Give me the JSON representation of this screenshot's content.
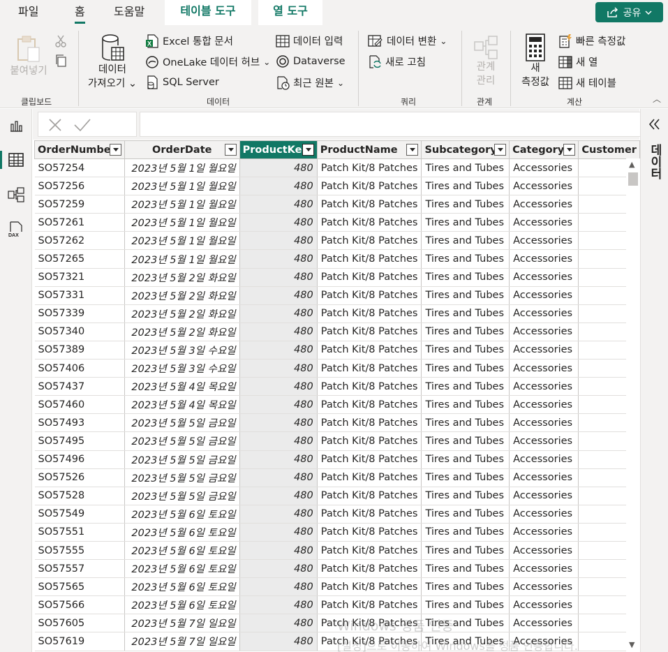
{
  "tabs": {
    "file": "파일",
    "home": "홈",
    "help": "도움말",
    "table_tools": "테이블 도구",
    "column_tools": "열 도구",
    "share": "공유"
  },
  "ribbon": {
    "clipboard": {
      "paste": "붙여넣기",
      "group": "클립보드"
    },
    "data": {
      "get_data_line1": "데이터",
      "get_data_line2": "가져오기",
      "excel": "Excel 통합 문서",
      "onelake": "OneLake 데이터 허브",
      "sql": "SQL Server",
      "enter_data": "데이터 입력",
      "dataverse": "Dataverse",
      "recent": "최근 원본",
      "group": "데이터"
    },
    "queries": {
      "transform": "데이터 변환",
      "refresh": "새로 고침",
      "group": "쿼리"
    },
    "relationships": {
      "manage_line1": "관계",
      "manage_line2": "관리",
      "group": "관계"
    },
    "calculations": {
      "new_measure_line1": "새",
      "new_measure_line2": "측정값",
      "quick_measure": "빠른 측정값",
      "new_column": "새 열",
      "new_table": "새 테이블",
      "group": "계산"
    }
  },
  "right_pane": {
    "title": "데이터"
  },
  "table": {
    "columns": [
      "OrderNumber",
      "OrderDate",
      "ProductKey",
      "ProductName",
      "Subcategory",
      "Category",
      "Customer"
    ],
    "selected_column": "ProductKey",
    "rows": [
      [
        "SO57254",
        "2023년 5월 1일 월요일",
        "480",
        "Patch Kit/8 Patches",
        "Tires and Tubes",
        "Accessories"
      ],
      [
        "SO57256",
        "2023년 5월 1일 월요일",
        "480",
        "Patch Kit/8 Patches",
        "Tires and Tubes",
        "Accessories"
      ],
      [
        "SO57259",
        "2023년 5월 1일 월요일",
        "480",
        "Patch Kit/8 Patches",
        "Tires and Tubes",
        "Accessories"
      ],
      [
        "SO57261",
        "2023년 5월 1일 월요일",
        "480",
        "Patch Kit/8 Patches",
        "Tires and Tubes",
        "Accessories"
      ],
      [
        "SO57262",
        "2023년 5월 1일 월요일",
        "480",
        "Patch Kit/8 Patches",
        "Tires and Tubes",
        "Accessories"
      ],
      [
        "SO57265",
        "2023년 5월 1일 월요일",
        "480",
        "Patch Kit/8 Patches",
        "Tires and Tubes",
        "Accessories"
      ],
      [
        "SO57321",
        "2023년 5월 2일 화요일",
        "480",
        "Patch Kit/8 Patches",
        "Tires and Tubes",
        "Accessories"
      ],
      [
        "SO57331",
        "2023년 5월 2일 화요일",
        "480",
        "Patch Kit/8 Patches",
        "Tires and Tubes",
        "Accessories"
      ],
      [
        "SO57339",
        "2023년 5월 2일 화요일",
        "480",
        "Patch Kit/8 Patches",
        "Tires and Tubes",
        "Accessories"
      ],
      [
        "SO57340",
        "2023년 5월 2일 화요일",
        "480",
        "Patch Kit/8 Patches",
        "Tires and Tubes",
        "Accessories"
      ],
      [
        "SO57389",
        "2023년 5월 3일 수요일",
        "480",
        "Patch Kit/8 Patches",
        "Tires and Tubes",
        "Accessories"
      ],
      [
        "SO57406",
        "2023년 5월 3일 수요일",
        "480",
        "Patch Kit/8 Patches",
        "Tires and Tubes",
        "Accessories"
      ],
      [
        "SO57437",
        "2023년 5월 4일 목요일",
        "480",
        "Patch Kit/8 Patches",
        "Tires and Tubes",
        "Accessories"
      ],
      [
        "SO57460",
        "2023년 5월 4일 목요일",
        "480",
        "Patch Kit/8 Patches",
        "Tires and Tubes",
        "Accessories"
      ],
      [
        "SO57493",
        "2023년 5월 5일 금요일",
        "480",
        "Patch Kit/8 Patches",
        "Tires and Tubes",
        "Accessories"
      ],
      [
        "SO57495",
        "2023년 5월 5일 금요일",
        "480",
        "Patch Kit/8 Patches",
        "Tires and Tubes",
        "Accessories"
      ],
      [
        "SO57496",
        "2023년 5월 5일 금요일",
        "480",
        "Patch Kit/8 Patches",
        "Tires and Tubes",
        "Accessories"
      ],
      [
        "SO57526",
        "2023년 5월 5일 금요일",
        "480",
        "Patch Kit/8 Patches",
        "Tires and Tubes",
        "Accessories"
      ],
      [
        "SO57528",
        "2023년 5월 5일 금요일",
        "480",
        "Patch Kit/8 Patches",
        "Tires and Tubes",
        "Accessories"
      ],
      [
        "SO57549",
        "2023년 5월 6일 토요일",
        "480",
        "Patch Kit/8 Patches",
        "Tires and Tubes",
        "Accessories"
      ],
      [
        "SO57551",
        "2023년 5월 6일 토요일",
        "480",
        "Patch Kit/8 Patches",
        "Tires and Tubes",
        "Accessories"
      ],
      [
        "SO57555",
        "2023년 5월 6일 토요일",
        "480",
        "Patch Kit/8 Patches",
        "Tires and Tubes",
        "Accessories"
      ],
      [
        "SO57557",
        "2023년 5월 6일 토요일",
        "480",
        "Patch Kit/8 Patches",
        "Tires and Tubes",
        "Accessories"
      ],
      [
        "SO57565",
        "2023년 5월 6일 토요일",
        "480",
        "Patch Kit/8 Patches",
        "Tires and Tubes",
        "Accessories"
      ],
      [
        "SO57566",
        "2023년 5월 6일 토요일",
        "480",
        "Patch Kit/8 Patches",
        "Tires and Tubes",
        "Accessories"
      ],
      [
        "SO57605",
        "2023년 5월 7일 일요일",
        "480",
        "Patch Kit/8 Patches",
        "Tires and Tubes",
        "Accessories"
      ],
      [
        "SO57619",
        "2023년 5월 7일 일요일",
        "480",
        "Patch Kit/8 Patches",
        "Tires and Tubes",
        "Accessories"
      ]
    ]
  },
  "watermark": {
    "line1": "Windows 정품 인증",
    "line2": "[설정]으로 이동하여 Windows를 정품 인증합니다."
  },
  "colors": {
    "accent": "#117865",
    "ribbon_bg": "#f3f2f1"
  }
}
